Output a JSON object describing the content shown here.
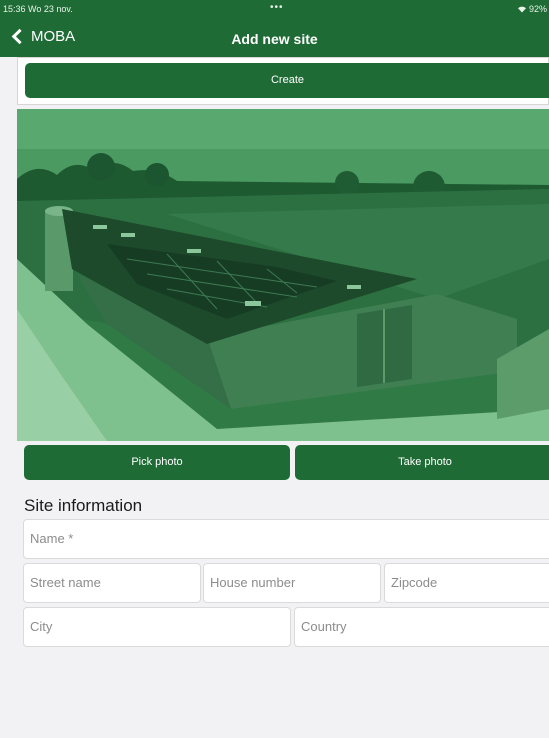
{
  "status_bar": {
    "time": "15:36  Wo 23 nov.",
    "dots": "•••",
    "battery": "92%"
  },
  "nav": {
    "back_label": "MOBA",
    "title": "Add new site"
  },
  "actions": {
    "create_label": "Create",
    "pick_photo_label": "Pick photo",
    "take_photo_label": "Take photo"
  },
  "form": {
    "section_title": "Site information",
    "name_placeholder": "Name *",
    "street_placeholder": "Street name",
    "house_number_placeholder": "House number",
    "zipcode_placeholder": "Zipcode",
    "city_placeholder": "City",
    "country_placeholder": "Country"
  },
  "colors": {
    "brand_green": "#1f6b35",
    "photo_tint": "#2f7a45",
    "background": "#f2f2f4"
  }
}
